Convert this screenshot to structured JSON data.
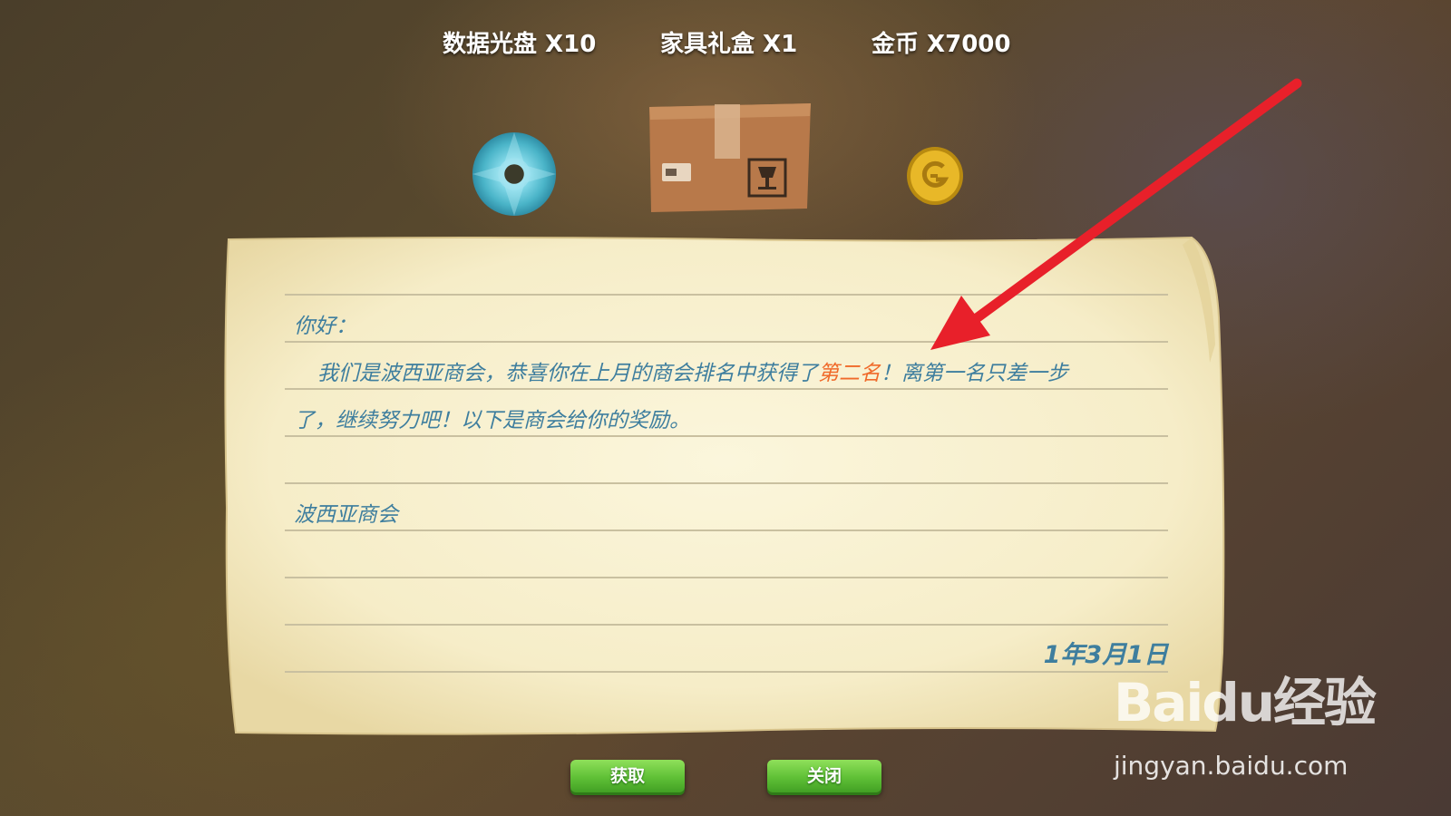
{
  "rewards": [
    {
      "label": "数据光盘 X10",
      "icon": "data-disc-icon"
    },
    {
      "label": "家具礼盒 X1",
      "icon": "furniture-box-icon"
    },
    {
      "label": "金币 X7000",
      "icon": "gold-coin-icon"
    }
  ],
  "letter": {
    "greeting": "你好：",
    "body_line1_before": "我们是波西亚商会，恭喜你在上月的商会排名中获得了",
    "body_line1_highlight": "第二名",
    "body_line1_after": "！离第一名只差一步",
    "body_line2": "了，继续努力吧！以下是商会给你的奖励。",
    "signature": "波西亚商会",
    "date": "1年3月1日"
  },
  "buttons": {
    "get_label": "获取",
    "close_label": "关闭"
  },
  "watermark": {
    "logo": "Baidu经验",
    "url": "jingyan.baidu.com"
  },
  "colors": {
    "letter_text": "#3e7e9e",
    "highlight": "#f06a2a",
    "button_green": "#5fc036",
    "arrow_red": "#e8202a"
  }
}
